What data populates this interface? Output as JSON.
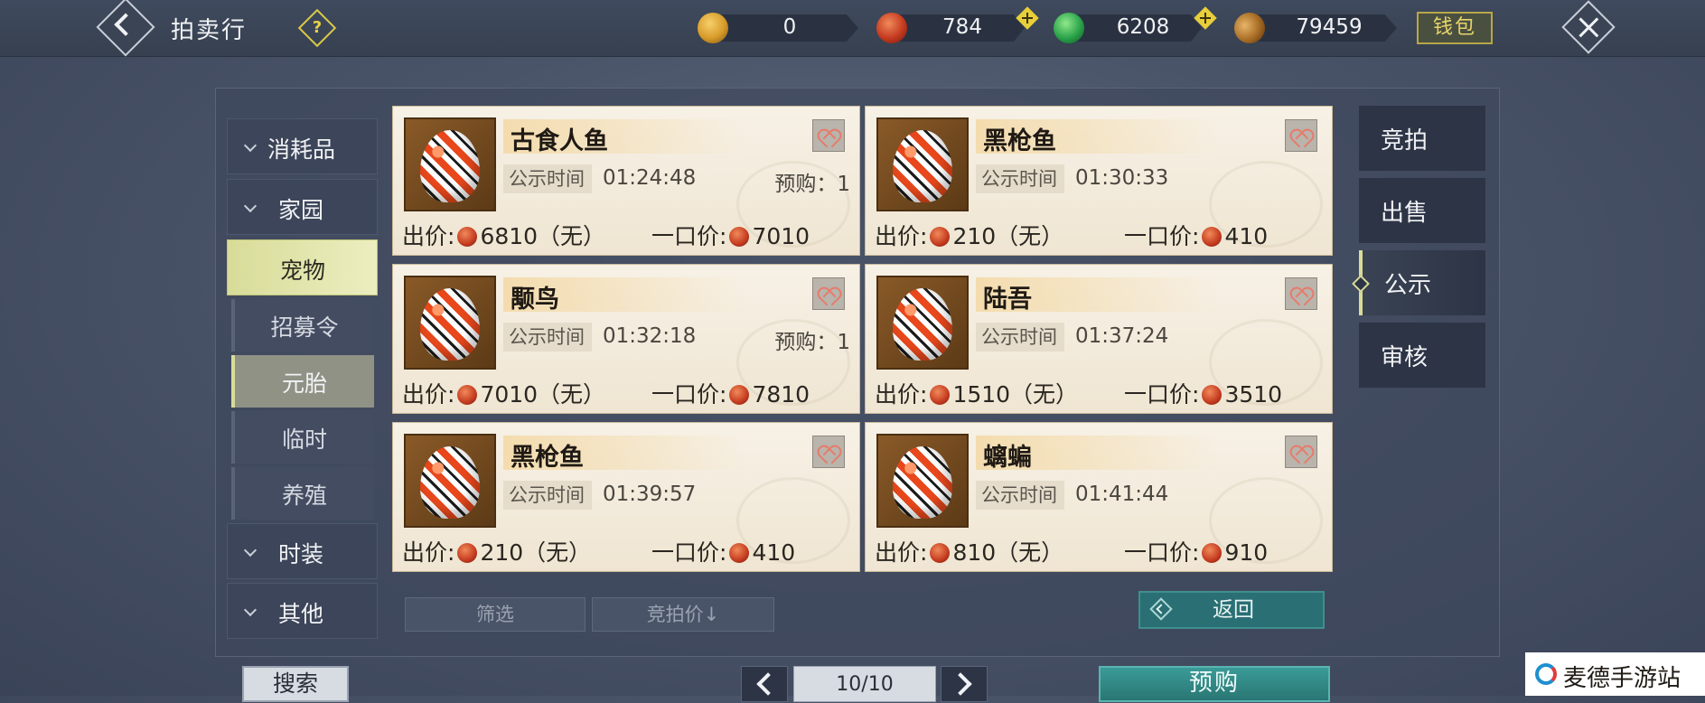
{
  "header": {
    "title": "拍卖行",
    "help_icon": "?",
    "wallet_label": "钱包",
    "currencies": [
      {
        "icon": "gold-coin-icon",
        "value": "0"
      },
      {
        "icon": "red-bead-icon",
        "value": "784"
      },
      {
        "icon": "jade-coin-icon",
        "value": "6208"
      },
      {
        "icon": "bronze-coin-icon",
        "value": "79459"
      }
    ]
  },
  "sidebar": {
    "categories": [
      {
        "label": "消耗品"
      },
      {
        "label": "家园"
      },
      {
        "label": "宠物"
      },
      {
        "label": "时装"
      },
      {
        "label": "其他"
      }
    ],
    "subcategories": [
      {
        "label": "招募令"
      },
      {
        "label": "元胎"
      },
      {
        "label": "临时"
      },
      {
        "label": "养殖"
      }
    ]
  },
  "items": [
    {
      "name": "古食人鱼",
      "time_label": "公示时间",
      "time": "01:24:48",
      "prebuy": "预购：1",
      "bid_label": "出价:",
      "bid": "6810（无）",
      "buyout_label": "一口价:",
      "buyout": "7010"
    },
    {
      "name": "黑枪鱼",
      "time_label": "公示时间",
      "time": "01:30:33",
      "prebuy": "",
      "bid_label": "出价:",
      "bid": "210（无）",
      "buyout_label": "一口价:",
      "buyout": "410"
    },
    {
      "name": "颙鸟",
      "time_label": "公示时间",
      "time": "01:32:18",
      "prebuy": "预购：1",
      "bid_label": "出价:",
      "bid": "7010（无）",
      "buyout_label": "一口价:",
      "buyout": "7810"
    },
    {
      "name": "陆吾",
      "time_label": "公示时间",
      "time": "01:37:24",
      "prebuy": "",
      "bid_label": "出价:",
      "bid": "1510（无）",
      "buyout_label": "一口价:",
      "buyout": "3510"
    },
    {
      "name": "黑枪鱼",
      "time_label": "公示时间",
      "time": "01:39:57",
      "prebuy": "",
      "bid_label": "出价:",
      "bid": "210（无）",
      "buyout_label": "一口价:",
      "buyout": "410"
    },
    {
      "name": "螭蝙",
      "time_label": "公示时间",
      "time": "01:41:44",
      "prebuy": "",
      "bid_label": "出价:",
      "bid": "810（无）",
      "buyout_label": "一口价:",
      "buyout": "910"
    }
  ],
  "controls": {
    "filter_label": "筛选",
    "sort_label": "竞拍价↓",
    "return_label": "返回",
    "search_label": "搜索",
    "page_text": "10/10",
    "prebuy_label": "预购"
  },
  "tabs": [
    {
      "label": "竞拍"
    },
    {
      "label": "出售"
    },
    {
      "label": "公示"
    },
    {
      "label": "审核"
    }
  ],
  "brand": {
    "text": "麦德手游站"
  }
}
